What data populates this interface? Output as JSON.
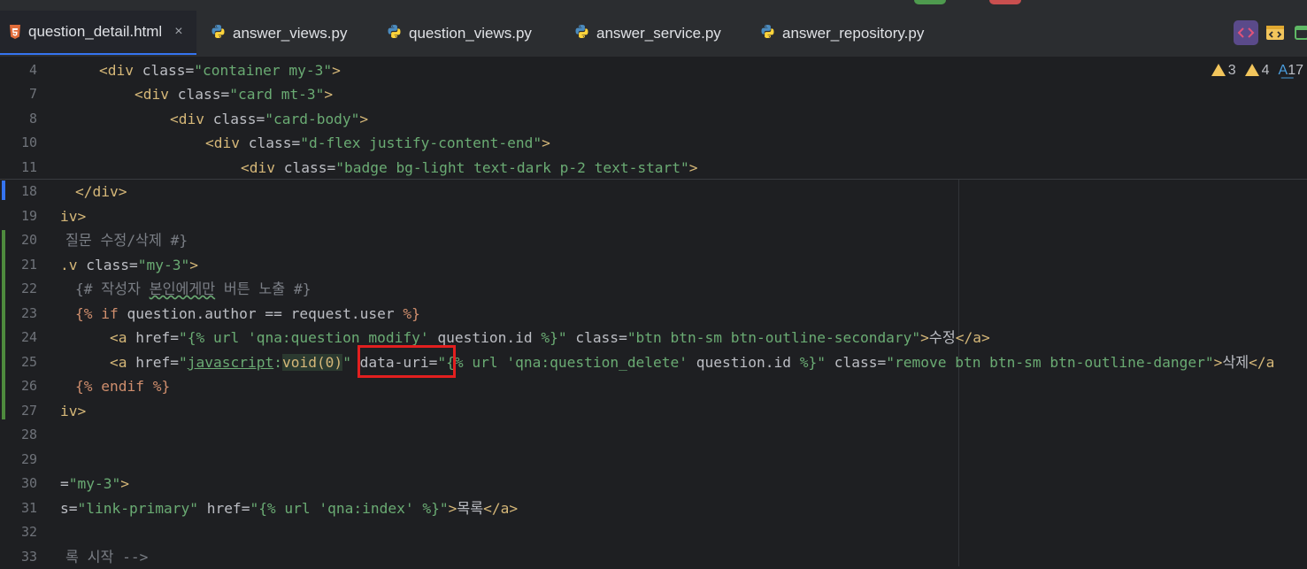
{
  "tabs": [
    {
      "label": "question_detail.html",
      "icon": "html5-icon",
      "active": true,
      "close": "×"
    },
    {
      "label": "answer_views.py",
      "icon": "python-icon"
    },
    {
      "label": "question_views.py",
      "icon": "python-icon"
    },
    {
      "label": "answer_service.py",
      "icon": "python-icon"
    },
    {
      "label": "answer_repository.py",
      "icon": "python-icon"
    }
  ],
  "toolbar_icons": [
    "code-view-icon",
    "preview-icon",
    "split-icon"
  ],
  "inspections": {
    "warnings_a": "3",
    "warnings_b": "4",
    "typos": "17"
  },
  "line_numbers": [
    "4",
    "7",
    "8",
    "10",
    "11",
    "18",
    "19",
    "20",
    "21",
    "22",
    "23",
    "24",
    "25",
    "26",
    "27",
    "28",
    "29",
    "30",
    "31",
    "32",
    "33"
  ],
  "code": {
    "l4_tag": "<div ",
    "l4_attr": "class",
    "l4_eq": "=",
    "l4_val": "\"container my-3\"",
    "l4_end": ">",
    "l7_tag": "<div ",
    "l7_attr": "class",
    "l7_eq": "=",
    "l7_val": "\"card mt-3\"",
    "l7_end": ">",
    "l8_tag": "<div ",
    "l8_attr": "class",
    "l8_eq": "=",
    "l8_val": "\"card-body\"",
    "l8_end": ">",
    "l10_tag": "<div ",
    "l10_attr": "class",
    "l10_eq": "=",
    "l10_val": "\"d-flex justify-content-end\"",
    "l10_end": ">",
    "l11_tag": "<div ",
    "l11_attr": "class",
    "l11_eq": "=",
    "l11_val": "\"badge bg-light text-dark p-2 text-start\"",
    "l11_end": ">",
    "l18": "</div>",
    "l19": "iv>",
    "l20": "질문 수정/삭제 #}",
    "l21_a": ".v ",
    "l21_b": "class",
    "l21_c": "=",
    "l21_d": "\"my-3\"",
    "l21_e": ">",
    "l22_a": "{# 작성자 ",
    "l22_b": "본인에게만",
    "l22_c": " 버튼 노출 #}",
    "l23_a": "{%",
    "l23_b": " if ",
    "l23_c": "question.author == request.user ",
    "l23_d": "%}",
    "l24_a": "<a ",
    "l24_b": "href",
    "l24_c": "=",
    "l24_d": "\"",
    "l24_e": "{% url 'qna:question_modify' ",
    "l24_f": "question.id",
    "l24_g": " %}",
    "l24_h": "\"",
    "l24_i": " class",
    "l24_j": "=",
    "l24_k": "\"btn btn-sm btn-outline-secondary\"",
    "l24_l": ">",
    "l24_m": "수정",
    "l24_n": "</a>",
    "l25_a": "<a ",
    "l25_b": "href",
    "l25_c": "=",
    "l25_d": "\"",
    "l25_e": "javascript",
    "l25_f": ":",
    "l25_g": "void",
    "l25_h": "(0)",
    "l25_i": "\"",
    "l25_j": " data-uri",
    "l25_k": "=",
    "l25_l": "\"",
    "l25_m": "{% url 'qna:question_delete' ",
    "l25_n": "question.id",
    "l25_o": " %}",
    "l25_p": "\"",
    "l25_q": " class",
    "l25_r": "=",
    "l25_s": "\"remove btn btn-sm btn-outline-danger\"",
    "l25_t": ">",
    "l25_u": "삭제",
    "l25_v": "</a",
    "l26_a": "{%",
    "l26_b": " endif ",
    "l26_c": "%}",
    "l27": "iv>",
    "l30_a": "=",
    "l30_b": "\"my-3\"",
    "l30_c": ">",
    "l31_a": "s",
    "l31_b": "=",
    "l31_c": "\"link-primary\"",
    "l31_d": " href",
    "l31_e": "=",
    "l31_f": "\"",
    "l31_g": "{% url 'qna:index' ",
    "l31_h": "%}",
    "l31_i": "\"",
    "l31_j": ">",
    "l31_k": "목록",
    "l31_l": "</a>",
    "l33": "록 시작 -->"
  },
  "colors": {
    "bg": "#1e1f22",
    "tabbar": "#2b2d30",
    "tag": "#d5b778",
    "string": "#6aab73",
    "comment": "#7a7e85",
    "keyword": "#cf8e6d",
    "highlight": "#e21f1f"
  }
}
